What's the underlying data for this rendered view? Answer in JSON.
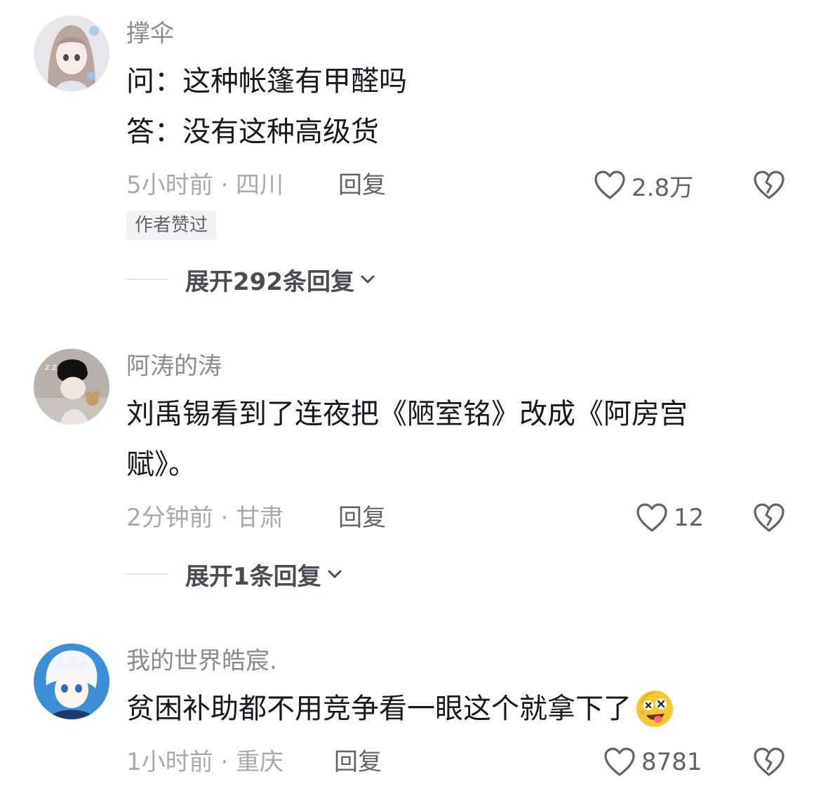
{
  "comments": [
    {
      "username": "撑伞",
      "lines": [
        "问：这种帐篷有甲醛吗",
        "答：没有这种高级货"
      ],
      "meta": "5小时前 · 四川",
      "reply_label": "回复",
      "likes": "2.8万",
      "badge": "作者赞过",
      "expand": "展开292条回复"
    },
    {
      "username": "阿涛的涛",
      "lines": [
        "刘禹锡看到了连夜把《陋室铭》改成《阿房宫",
        "赋》。"
      ],
      "meta": "2分钟前 · 甘肃",
      "reply_label": "回复",
      "likes": "12",
      "expand": "展开1条回复"
    },
    {
      "username": "我的世界皓宸.",
      "lines": [
        "贫困补助都不用竞争看一眼这个就拿下了"
      ],
      "meta": "1小时前 · 重庆",
      "reply_label": "回复",
      "likes": "8781"
    }
  ],
  "icons": {
    "like": "heart-outline-icon",
    "dislike": "broken-heart-icon",
    "expand": "chevron-down-icon",
    "emoji": "drooling-face-emoji-icon"
  },
  "colors": {
    "text": "#161823",
    "secondary": "#8a8b91",
    "muted": "#a8a9ad",
    "action": "#61636b"
  }
}
